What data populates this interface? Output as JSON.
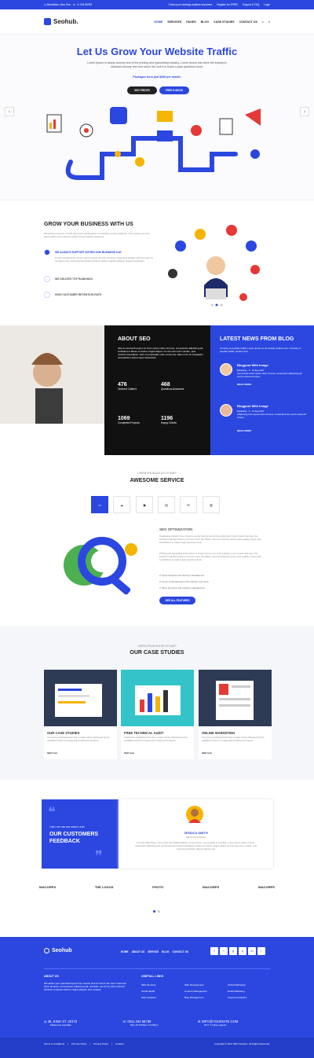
{
  "topbar": {
    "location": "Manhattan, New York",
    "phone": "+1 234 56789",
    "links": [
      "Check your rankings anytime anywhere",
      "Register for FREE!",
      "Support & FAQ",
      "Login"
    ]
  },
  "nav": {
    "brand": "Seohub.",
    "items": [
      "HOME",
      "SERVICES",
      "PAGES",
      "BLOG",
      "CASE STUDIES",
      "CONTACT US"
    ]
  },
  "hero": {
    "title": "Let Us Grow Your Website Traffic",
    "subtitle": "Lorem Ipsum is simply dummy text of the printing and typesetting industry. Lorem Ipsum has been the industry's standard dummy text ever since the look it to make a type specimen book.",
    "packages": "Packages from just $299 per month.",
    "btn1": "SEO PRICES",
    "btn2": "FREE E-BOOK"
  },
  "grow": {
    "title": "GROW YOUR BUSINESS WITH US",
    "text": "We assist everyone to both grow and maintenance competitive of your business. This means you can accomplish your business goals through digital marketing.",
    "features": [
      {
        "label": "WE ALWAYS SUPPORT WITHIN ONE BUSINESS DAY",
        "desc": "Torque consequuntur vel dui nostrum ipsum qui dolor sit amet, consectetur adipisc, velit sed quia non numquam eius modi tempora incidunt ut labore dolore magnam aliquam quaerat voluptatem."
      },
      {
        "label": "WE DELIVER TOP RANKINGS"
      },
      {
        "label": "HIGH CUSTOMER RETENTION RATE"
      }
    ]
  },
  "about": {
    "title": "ABOUT SEO",
    "text": "Sed do eiusmod tempor for lorem ipsum dolor sit amet, consectetur adipiscing elit, incididunt ut labore et dolore magna aliqua. Ut enim ad minim veniam, quis nostrud exercitation. Sed ut perspiciatis unde omnis iste natus error sit voluptatem accusantium doloremque laudantium.",
    "stats": [
      {
        "n": "476",
        "l": "Ordered Coffee's"
      },
      {
        "n": "468",
        "l": "Questions Answered"
      },
      {
        "n": "1069",
        "l": "Completed Projects"
      },
      {
        "n": "1196",
        "l": "Happy Clients"
      }
    ]
  },
  "news": {
    "title": "LATEST NEWS FROM BLOG",
    "intro": "Contrary to popular belief, Lorem Ipsum is not simply random text. Contrary to popular belief, random text.",
    "posts": [
      {
        "title": "Blogpost With Image",
        "cat": "Marketing",
        "comments": "5",
        "date": "12 Aug 2017",
        "text": "Consectetur lorem ipsum dolor sit amet, consectetur adipiscing elit, sed do eiusmod tempor.",
        "more": "READ MORE"
      },
      {
        "title": "Blogpost With Image",
        "cat": "Marketing",
        "comments": "5",
        "date": "12 Aug 2017",
        "text": "Adipiscing lorem ipsum dolor sit amet, consectetur elit, sed do eiusmod tempor.",
        "more": "READ MORE"
      }
    ]
  },
  "service": {
    "eyebrow": "LOREM IPSUM DOLOR SIT AMET",
    "title": "AWESOME SERVICE",
    "tab_title": "SEO OPTIMIZATION",
    "p1": "Typesetting industry lorem ipsum is simply dummy text of the printing and. Lorem Ipsum has been the industry's standard dummy text ever since the 1500s, when an unknown printer took a galley of type and scrambled it to make a type specimen book.",
    "p2": "Printing and typesetting lorem ipsum is simply dummy text of the industry. Lorem Ipsum has been the industry's standard dummy text ever since the 1500s, when an unknown printer took a galley of type and scrambled it to make a type specimen book.",
    "checks": [
      "Ipsum has been the industry's standard text",
      "Lorem is standard text of the industry ever since",
      "Since the ipsum has industry's standard text"
    ],
    "btn": "SEE ALL FEATURES"
  },
  "cases": {
    "eyebrow": "LOREM IPSUM DOLOR SIT AMET",
    "title": "OUR CASE STUDIES",
    "items": [
      {
        "t": "OUR CASE STUDIES",
        "d": "It is a long established fact that a reader will be distracted by the readable content of a page when looking at its layout.",
        "m": "SEO hub"
      },
      {
        "t": "FREE TECHINCAL AUDIT",
        "d": "It has been established fact that a reader will be distracted by the readable content of a page when looking at its layout.",
        "m": "SEO hub"
      },
      {
        "t": "ONLINE MARKETING",
        "d": "It is a long established fact that a reader will be distracted by the readable content of a page when looking at its layout.",
        "m": "SEO hub"
      }
    ]
  },
  "testi": {
    "eyebrow": "THEY SAY WE DID GREAT JOB!",
    "title": "OUR CUSTOMERS FEEDBACK",
    "name": "JESSICA SMITH",
    "role": "Manzona Software",
    "quote": "It so fam SEO Name. One of the best Market Mission Lorem Ipsum. Good quality is excellent. Lorem ipsum dolor sit amet, consectetur adipiscing elit, sed do eiusmod tempor incididunt ut labore et dolore magna aliqua. Ut enim ad minim veniam, quis nostrud exercitation ullamco laboris nisi.",
    "logos": [
      "INACORPS",
      "THE LOGOS",
      "PHOTO",
      "INACORPS",
      "INACORPS"
    ]
  },
  "footer": {
    "brand": "Seohub",
    "links": [
      "HOME",
      "ABOUT US",
      "SERVICE",
      "BLOG",
      "CONTACT US"
    ],
    "about_title": "ABOUT US",
    "about": "We attract your potential buyers from search and turn them into new customers. Quiet all amet, consectetuer adipiscing elit, sed diam nonummy nibh euismod tincidunt ut laoreet dolore magna aliquam erat volutpat.",
    "useful_title": "USEFULL LINKS",
    "useful": [
      "SEO Services",
      "Web Development",
      "Virtual Marketing",
      "Social Media",
      "Content Management",
      "Email Marketing",
      "Web Analytics",
      "Blog Management",
      "Keyword Analytics"
    ],
    "addr": "25, KING ST. 20170",
    "addr2": "Melbourne Australia",
    "phone": "0011 234 56789",
    "phone2": "Mon-Fri 8:30am to 6:30pm",
    "email": "INFO@YOURSITE.COM",
    "email2": "24 X 7 online support",
    "bottom": [
      "Terms & Conditions",
      "API Use Policy",
      "Privacy Policy",
      "Cookies"
    ],
    "copy": "Copyright © 2017 SEO Solution. All Rights Reserved."
  },
  "colors": {
    "accent": "#2b47e0",
    "dark": "#111111"
  }
}
